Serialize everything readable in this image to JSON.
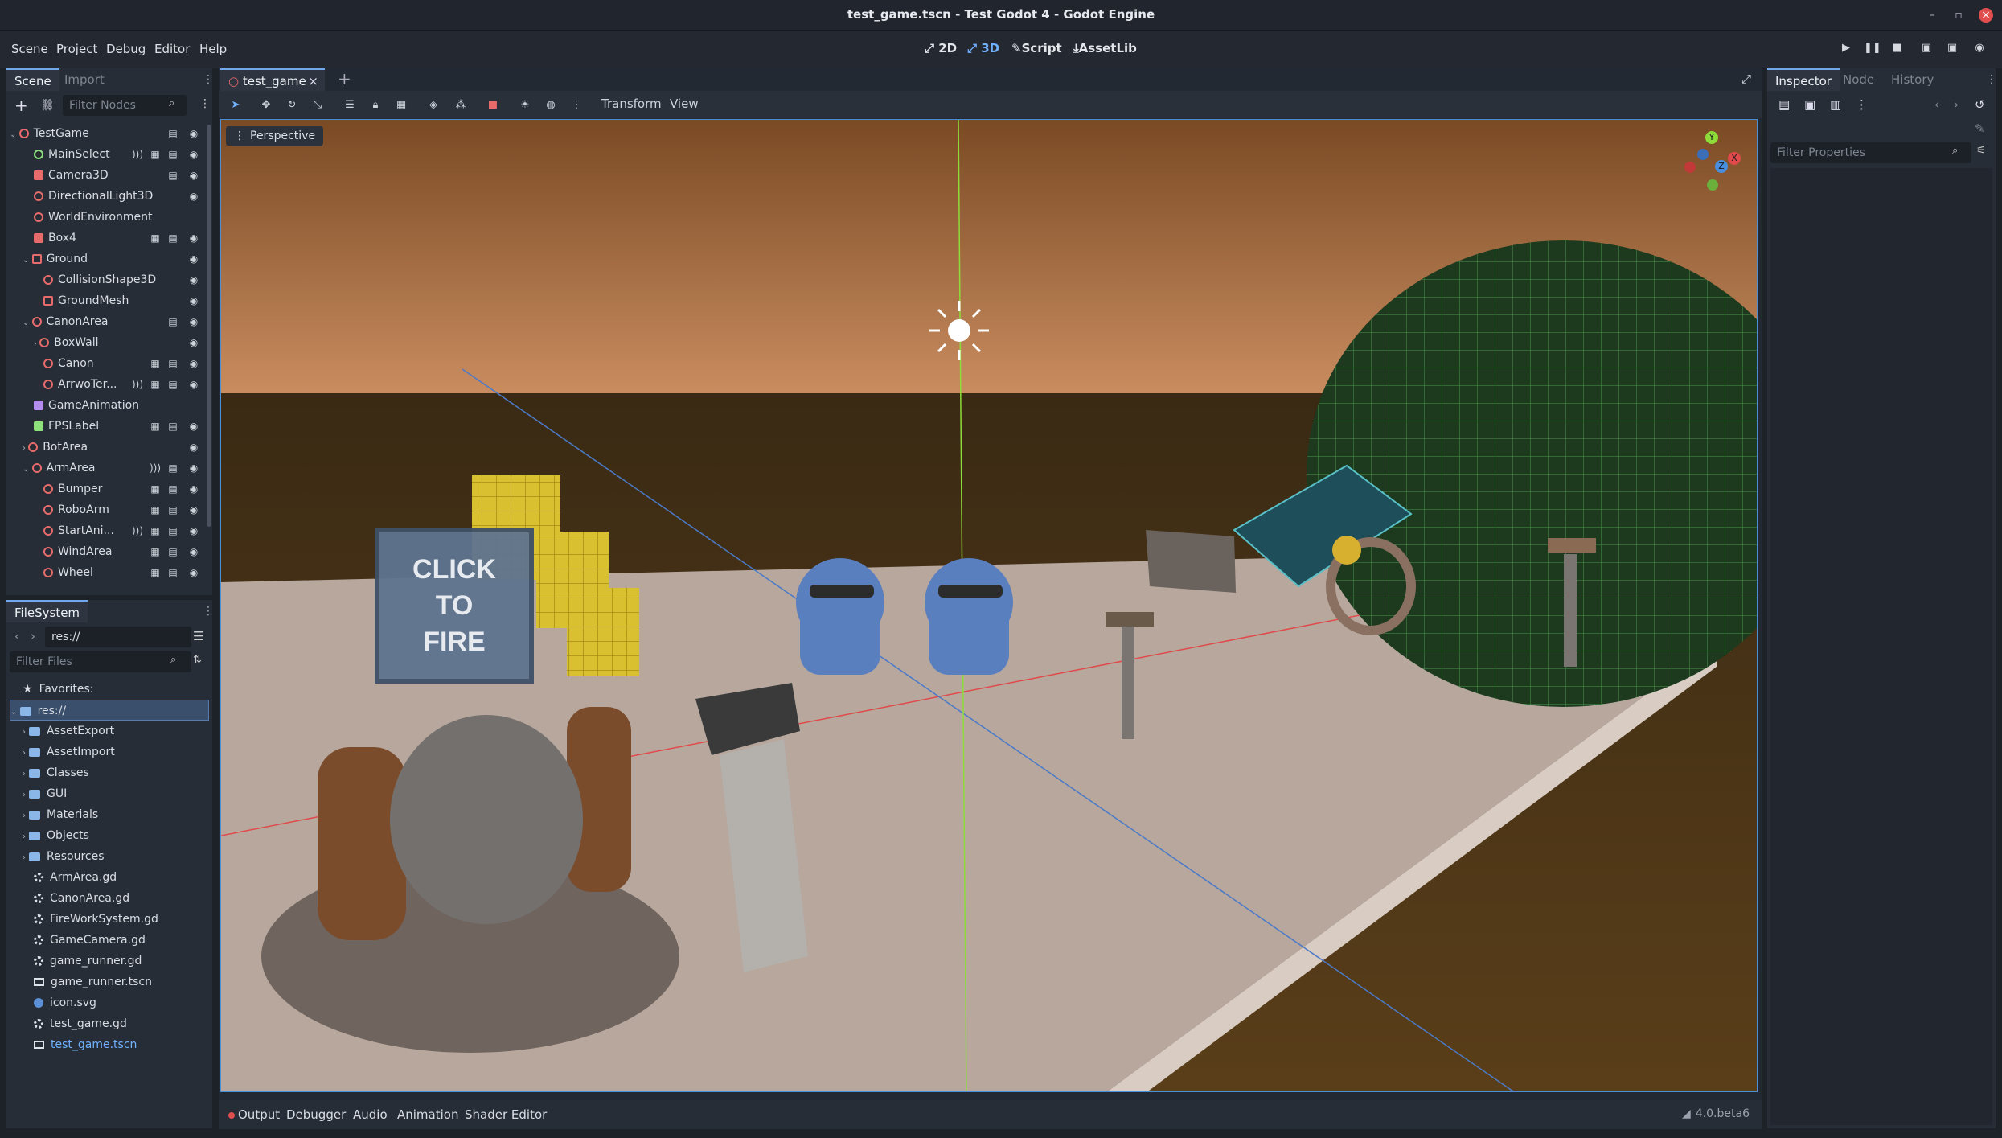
{
  "window": {
    "title": "test_game.tscn - Test Godot 4 - Godot Engine"
  },
  "menu": {
    "items": [
      "Scene",
      "Project",
      "Debug",
      "Editor",
      "Help"
    ]
  },
  "main_screens": {
    "twod": "2D",
    "threed": "3D",
    "script": "Script",
    "assetlib": "AssetLib"
  },
  "scene_dock": {
    "tabs": [
      "Scene",
      "Import"
    ],
    "filter_placeholder": "Filter Nodes",
    "nodes": [
      {
        "label": "TestGame"
      },
      {
        "label": "MainSelect"
      },
      {
        "label": "Camera3D"
      },
      {
        "label": "DirectionalLight3D"
      },
      {
        "label": "WorldEnvironment"
      },
      {
        "label": "Box4"
      },
      {
        "label": "Ground"
      },
      {
        "label": "CollisionShape3D"
      },
      {
        "label": "GroundMesh"
      },
      {
        "label": "CanonArea"
      },
      {
        "label": "BoxWall"
      },
      {
        "label": "Canon"
      },
      {
        "label": "ArrwoTer..."
      },
      {
        "label": "GameAnimation"
      },
      {
        "label": "FPSLabel"
      },
      {
        "label": "BotArea"
      },
      {
        "label": "ArmArea"
      },
      {
        "label": "Bumper"
      },
      {
        "label": "RoboArm"
      },
      {
        "label": "StartAni..."
      },
      {
        "label": "WindArea"
      },
      {
        "label": "Wheel"
      }
    ]
  },
  "filesystem": {
    "title": "FileSystem",
    "path": "res://",
    "filter_placeholder": "Filter Files",
    "favorites": "Favorites:",
    "root": "res://",
    "items": [
      {
        "label": "AssetExport",
        "kind": "folder"
      },
      {
        "label": "AssetImport",
        "kind": "folder"
      },
      {
        "label": "Classes",
        "kind": "folder"
      },
      {
        "label": "GUI",
        "kind": "folder"
      },
      {
        "label": "Materials",
        "kind": "folder"
      },
      {
        "label": "Objects",
        "kind": "folder"
      },
      {
        "label": "Resources",
        "kind": "folder"
      },
      {
        "label": "ArmArea.gd",
        "kind": "script"
      },
      {
        "label": "CanonArea.gd",
        "kind": "script"
      },
      {
        "label": "FireWorkSystem.gd",
        "kind": "script"
      },
      {
        "label": "GameCamera.gd",
        "kind": "script"
      },
      {
        "label": "game_runner.gd",
        "kind": "script"
      },
      {
        "label": "game_runner.tscn",
        "kind": "scene"
      },
      {
        "label": "icon.svg",
        "kind": "svg"
      },
      {
        "label": "test_game.gd",
        "kind": "script"
      },
      {
        "label": "test_game.tscn",
        "kind": "scene"
      }
    ]
  },
  "editor_tab": {
    "label": "test_game"
  },
  "viewport_toolbar": {
    "transform": "Transform",
    "view": "View"
  },
  "viewport": {
    "perspective": "Perspective",
    "sign_text": [
      "CLICK",
      "TO",
      "FIRE"
    ],
    "gizmo": {
      "x": "X",
      "y": "Y",
      "z": "Z"
    }
  },
  "inspector": {
    "tabs": [
      "Inspector",
      "Node",
      "History"
    ],
    "filter_placeholder": "Filter Properties"
  },
  "bottom_panel": {
    "tabs": [
      "Output",
      "Debugger",
      "Audio",
      "Animation",
      "Shader Editor"
    ],
    "version": "4.0.beta6"
  },
  "colors": {
    "accent": "#6fb2ff",
    "close": "#e04e4e",
    "sky_top": "#7a4a24",
    "floor": "#b9aaa0"
  }
}
